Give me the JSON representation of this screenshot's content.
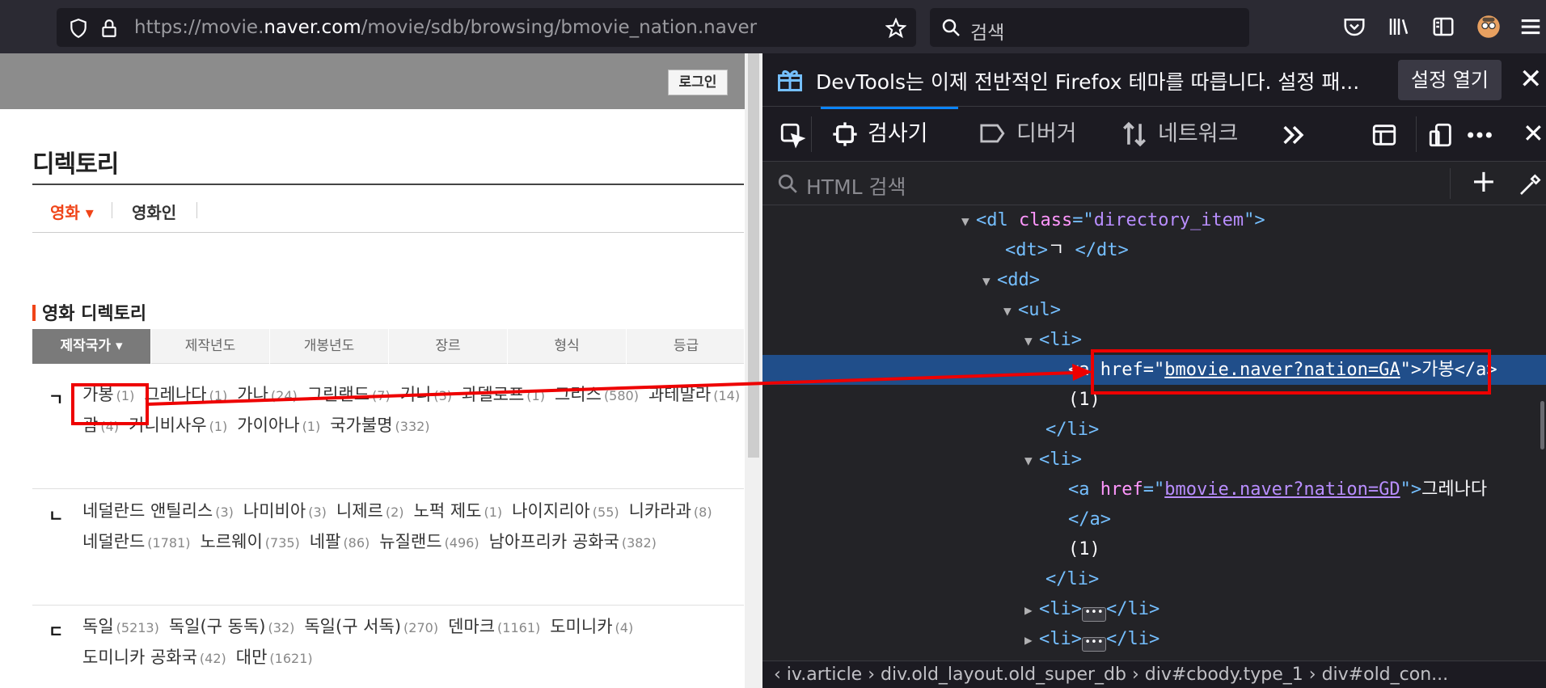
{
  "browser": {
    "url_prefix": "https://movie.",
    "url_domain": "naver.com",
    "url_path": "/movie/sdb/browsing/bmovie_nation.naver",
    "search_placeholder": "검색"
  },
  "page": {
    "login_label": "로그인",
    "directory_title": "디렉토리",
    "subnav": {
      "movie": "영화 ▾",
      "person": "영화인"
    },
    "section_title": "영화 디렉토리",
    "tabs": [
      {
        "label": "제작국가 ▾",
        "active": true
      },
      {
        "label": "제작년도"
      },
      {
        "label": "개봉년도"
      },
      {
        "label": "장르"
      },
      {
        "label": "형식"
      },
      {
        "label": "등급"
      }
    ],
    "groups": [
      {
        "letter": "ㄱ",
        "items": [
          {
            "name": "가봉",
            "count": "(1)"
          },
          {
            "name": "그레나다",
            "count": "(1)"
          },
          {
            "name": "가나",
            "count": "(24)"
          },
          {
            "name": "그린랜드",
            "count": "(7)"
          },
          {
            "name": "기니",
            "count": "(3)"
          },
          {
            "name": "과델로프",
            "count": "(1)"
          },
          {
            "name": "그리스",
            "count": "(580)"
          },
          {
            "name": "과테말라",
            "count": "(14)"
          },
          {
            "name": "괌",
            "count": "(4)"
          },
          {
            "name": "기니비사우",
            "count": "(1)"
          },
          {
            "name": "가이아나",
            "count": "(1)"
          },
          {
            "name": "국가불명",
            "count": "(332)"
          }
        ]
      },
      {
        "letter": "ㄴ",
        "items": [
          {
            "name": "네덜란드 앤틸리스",
            "count": "(3)"
          },
          {
            "name": "나미비아",
            "count": "(3)"
          },
          {
            "name": "니제르",
            "count": "(2)"
          },
          {
            "name": "노퍽 제도",
            "count": "(1)"
          },
          {
            "name": "나이지리아",
            "count": "(55)"
          },
          {
            "name": "니카라과",
            "count": "(8)"
          },
          {
            "name": "네덜란드",
            "count": "(1781)"
          },
          {
            "name": "노르웨이",
            "count": "(735)"
          },
          {
            "name": "네팔",
            "count": "(86)"
          },
          {
            "name": "뉴질랜드",
            "count": "(496)"
          },
          {
            "name": "남아프리카 공화국",
            "count": "(382)"
          }
        ]
      },
      {
        "letter": "ㄷ",
        "items": [
          {
            "name": "독일",
            "count": "(5213)"
          },
          {
            "name": "독일(구 동독)",
            "count": "(32)"
          },
          {
            "name": "독일(구 서독)",
            "count": "(270)"
          },
          {
            "name": "덴마크",
            "count": "(1161)"
          },
          {
            "name": "도미니카",
            "count": "(4)"
          },
          {
            "name": "도미니카 공화국",
            "count": "(42)"
          },
          {
            "name": "대만",
            "count": "(1621)"
          }
        ]
      }
    ]
  },
  "devtools": {
    "notice": "DevTools는 이제 전반적인 Firefox 테마를 따릅니다. 설정 패...",
    "notice_button": "설정 열기",
    "tabs": {
      "inspector": "검사기",
      "debugger": "디버거",
      "network": "네트워크"
    },
    "search_placeholder": "HTML 검색",
    "dom": {
      "dl_class": "directory_item",
      "dt_text": "ㄱ",
      "href1": "bmovie.naver?nation=GA",
      "text1": "가봉",
      "count1": "(1)",
      "href2": "bmovie.naver?nation=GD",
      "text2": "그레나다",
      "count2": "(1)"
    },
    "breadcrumbs": "‹  iv.article  ›  div.old_layout.old_super_db  ›  div#cbody.type_1  ›  div#old_con..."
  },
  "colors": {
    "accent": "#f04418",
    "annotation": "#ee0000",
    "devtools_selected": "#204e8a"
  }
}
